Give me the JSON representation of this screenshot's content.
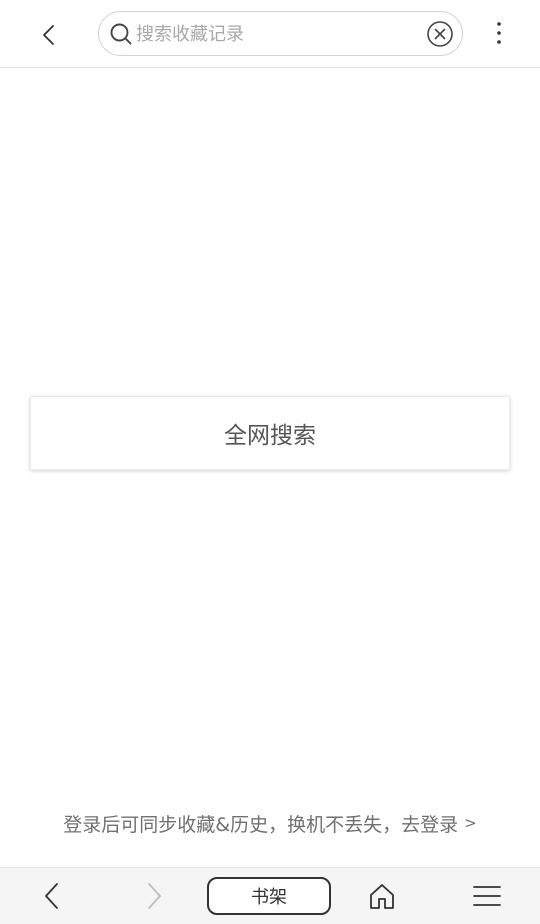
{
  "header": {
    "search_placeholder": "搜索收藏记录",
    "search_value": ""
  },
  "main": {
    "search_all_label": "全网搜索"
  },
  "login_tip": {
    "text": "登录后可同步收藏&历史，换机不丢失，去登录",
    "arrow": ">"
  },
  "bottom_bar": {
    "bookshelf_label": "书架"
  },
  "icons": {
    "back": "chevron-left-icon",
    "search": "search-icon",
    "clear": "clear-circle-icon",
    "more": "more-vertical-icon",
    "forward": "chevron-right-icon",
    "home": "home-icon",
    "menu": "menu-icon"
  },
  "colors": {
    "background": "#ffffff",
    "bottom_bar_bg": "#f5f5f5",
    "text_primary": "#333333",
    "text_secondary": "#707070",
    "placeholder": "#a8a8a8",
    "forward_disabled": "#bdbdbd"
  }
}
